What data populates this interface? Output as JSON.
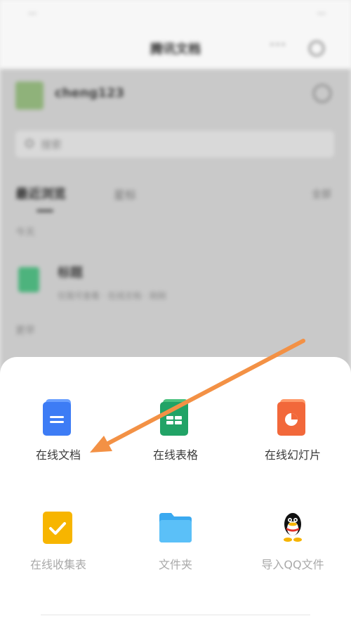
{
  "status_bar": {
    "left": "...",
    "right": "..."
  },
  "header": {
    "title": "腾讯文档"
  },
  "user": {
    "name": "cheng123"
  },
  "search": {
    "placeholder": "搜索"
  },
  "tabs": {
    "recent": "最近浏览",
    "starred": "星标",
    "filter": "全部"
  },
  "sections": {
    "today": "今天",
    "earlier": "更早"
  },
  "file": {
    "name": "标题",
    "meta": "仅我可查看 · 在线文档 · 刚刚"
  },
  "sheet": {
    "options": [
      {
        "label": "在线文档",
        "icon": "online-doc-icon"
      },
      {
        "label": "在线表格",
        "icon": "online-sheet-icon"
      },
      {
        "label": "在线幻灯片",
        "icon": "online-slides-icon"
      },
      {
        "label": "在线收集表",
        "icon": "online-form-icon"
      },
      {
        "label": "文件夹",
        "icon": "folder-icon"
      },
      {
        "label": "导入QQ文件",
        "icon": "qq-penguin-icon"
      }
    ]
  },
  "colors": {
    "arrow": "#f39145",
    "doc_blue": "#3d7cf5",
    "sheet_green": "#21a366",
    "slides_orange": "#f2683a",
    "form_yellow": "#f7b500",
    "folder_blue": "#3aa9f0"
  }
}
